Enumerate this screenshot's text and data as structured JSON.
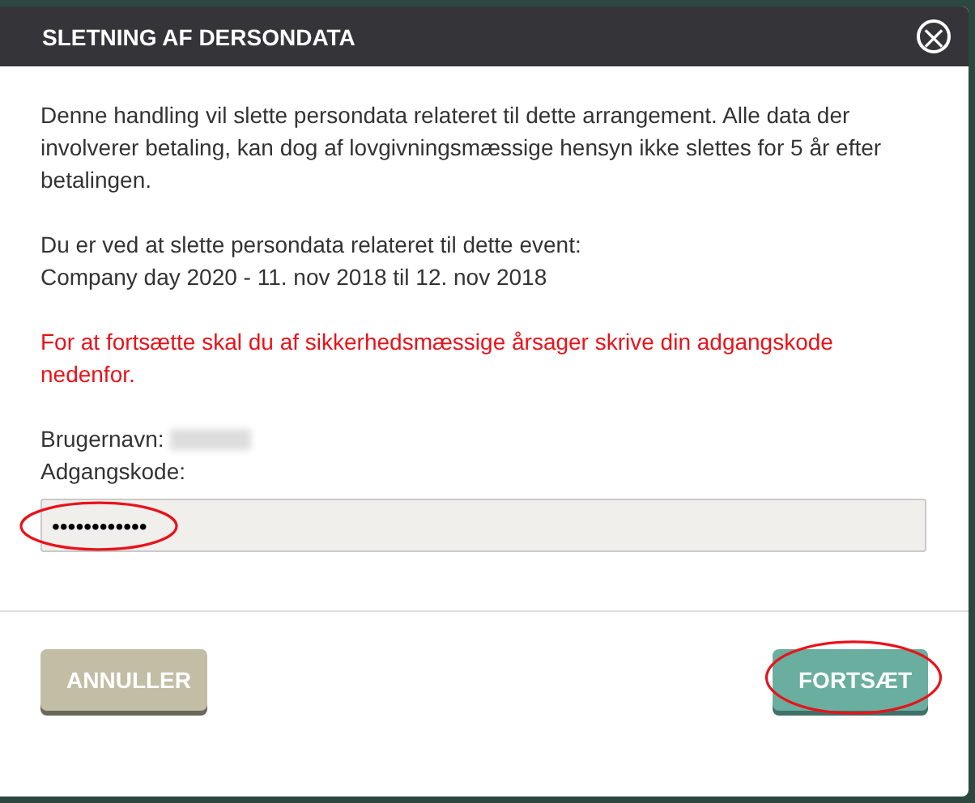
{
  "dialog": {
    "title": "SLETNING AF DERSONDATA",
    "close_icon": "×"
  },
  "paragraphs": [
    {
      "kind": "normal",
      "text": "Denne handling vil slette persondata relateret til dette arrangement. Alle data der involverer betaling, kan dog af lovgivningsmæssige hensyn ikke slettes for 5 år efter betalingen."
    },
    {
      "kind": "normal",
      "text": "Du er ved at slette persondata relateret til dette event:\nCompany day 2020 - 11. nov 2018 til 12. nov 2018"
    },
    {
      "kind": "warning",
      "text": "For at fortsætte skal du af sikkerhedsmæssige årsager skrive din adgangskode nedenfor."
    }
  ],
  "username_label": "Brugernavn:",
  "password_label": "Adgangskode:",
  "password_value": "••••••••••••",
  "buttons": [
    {
      "kind": "cancel",
      "label": "ANNULLER"
    },
    {
      "kind": "continue",
      "label": "FORTSÆT"
    }
  ]
}
